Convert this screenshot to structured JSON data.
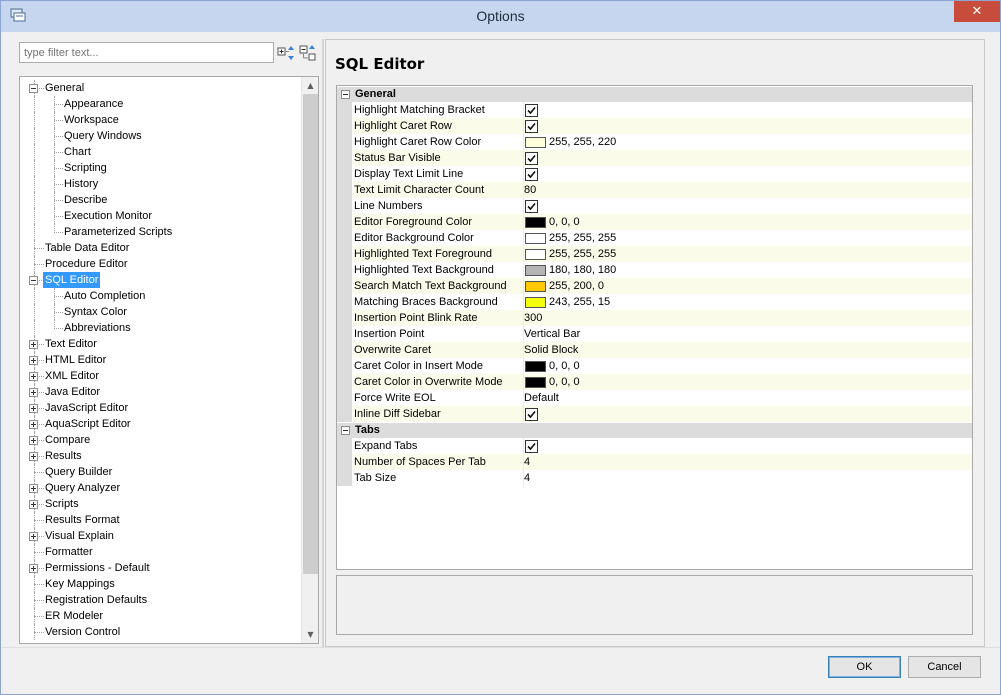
{
  "window": {
    "title": "Options",
    "close_glyph": "✕",
    "close_icon": "close-icon",
    "app_icon": "app-icon"
  },
  "filter": {
    "placeholder": "type filter text...",
    "value": "",
    "expand_icon": "expand-all-icon",
    "collapse_icon": "collapse-all-icon"
  },
  "tree": {
    "selected": "SQL Editor",
    "items": [
      {
        "label": "General",
        "depth": 0,
        "expander": "minus"
      },
      {
        "label": "Appearance",
        "depth": 1
      },
      {
        "label": "Workspace",
        "depth": 1
      },
      {
        "label": "Query Windows",
        "depth": 1
      },
      {
        "label": "Chart",
        "depth": 1
      },
      {
        "label": "Scripting",
        "depth": 1
      },
      {
        "label": "History",
        "depth": 1
      },
      {
        "label": "Describe",
        "depth": 1
      },
      {
        "label": "Execution Monitor",
        "depth": 1
      },
      {
        "label": "Parameterized Scripts",
        "depth": 1
      },
      {
        "label": "Table Data Editor",
        "depth": 0
      },
      {
        "label": "Procedure Editor",
        "depth": 0
      },
      {
        "label": "SQL Editor",
        "depth": 0,
        "expander": "minus"
      },
      {
        "label": "Auto Completion",
        "depth": 1
      },
      {
        "label": "Syntax Color",
        "depth": 1
      },
      {
        "label": "Abbreviations",
        "depth": 1
      },
      {
        "label": "Text Editor",
        "depth": 0,
        "expander": "plus"
      },
      {
        "label": "HTML Editor",
        "depth": 0,
        "expander": "plus"
      },
      {
        "label": "XML Editor",
        "depth": 0,
        "expander": "plus"
      },
      {
        "label": "Java Editor",
        "depth": 0,
        "expander": "plus"
      },
      {
        "label": "JavaScript Editor",
        "depth": 0,
        "expander": "plus"
      },
      {
        "label": "AquaScript Editor",
        "depth": 0,
        "expander": "plus"
      },
      {
        "label": "Compare",
        "depth": 0,
        "expander": "plus"
      },
      {
        "label": "Results",
        "depth": 0,
        "expander": "plus"
      },
      {
        "label": "Query Builder",
        "depth": 0
      },
      {
        "label": "Query Analyzer",
        "depth": 0,
        "expander": "plus"
      },
      {
        "label": "Scripts",
        "depth": 0,
        "expander": "plus"
      },
      {
        "label": "Results Format",
        "depth": 0
      },
      {
        "label": "Visual Explain",
        "depth": 0,
        "expander": "plus"
      },
      {
        "label": "Formatter",
        "depth": 0
      },
      {
        "label": "Permissions - Default",
        "depth": 0,
        "expander": "plus"
      },
      {
        "label": "Key Mappings",
        "depth": 0
      },
      {
        "label": "Registration Defaults",
        "depth": 0
      },
      {
        "label": "ER Modeler",
        "depth": 0
      },
      {
        "label": "Version Control",
        "depth": 0
      }
    ]
  },
  "page": {
    "title": "SQL Editor",
    "categories": [
      {
        "name": "General",
        "props": [
          {
            "name": "Highlight Matching Bracket",
            "type": "check",
            "checked": true
          },
          {
            "name": "Highlight Caret Row",
            "type": "check",
            "checked": true
          },
          {
            "name": "Highlight Caret Row Color",
            "type": "color",
            "color": "#ffffdc",
            "text": "255, 255, 220"
          },
          {
            "name": "Status Bar Visible",
            "type": "check",
            "checked": true
          },
          {
            "name": "Display Text Limit Line",
            "type": "check",
            "checked": true
          },
          {
            "name": "Text Limit Character Count",
            "type": "text",
            "text": "80"
          },
          {
            "name": "Line Numbers",
            "type": "check",
            "checked": true
          },
          {
            "name": "Editor Foreground Color",
            "type": "color",
            "color": "#000000",
            "text": "0, 0, 0"
          },
          {
            "name": "Editor Background Color",
            "type": "color",
            "color": "#ffffff",
            "text": "255, 255, 255"
          },
          {
            "name": "Highlighted Text Foreground",
            "type": "color",
            "color": "#ffffff",
            "text": "255, 255, 255"
          },
          {
            "name": "Highlighted Text Background",
            "type": "color",
            "color": "#b4b4b4",
            "text": "180, 180, 180"
          },
          {
            "name": "Search Match Text Background",
            "type": "color",
            "color": "#ffc800",
            "text": "255, 200, 0"
          },
          {
            "name": "Matching Braces Background",
            "type": "color",
            "color": "#f3ff0f",
            "text": "243, 255, 15"
          },
          {
            "name": "Insertion Point Blink Rate",
            "type": "text",
            "text": "300"
          },
          {
            "name": "Insertion Point",
            "type": "text",
            "text": "Vertical Bar"
          },
          {
            "name": "Overwrite Caret",
            "type": "text",
            "text": "Solid Block"
          },
          {
            "name": "Caret Color in Insert Mode",
            "type": "color",
            "color": "#000000",
            "text": "0, 0, 0"
          },
          {
            "name": "Caret Color in Overwrite Mode",
            "type": "color",
            "color": "#000000",
            "text": "0, 0, 0"
          },
          {
            "name": "Force Write EOL",
            "type": "text",
            "text": "Default"
          },
          {
            "name": "Inline Diff Sidebar",
            "type": "check",
            "checked": true
          }
        ]
      },
      {
        "name": "Tabs",
        "props": [
          {
            "name": "Expand Tabs",
            "type": "check",
            "checked": true
          },
          {
            "name": "Number of Spaces Per Tab",
            "type": "text",
            "text": "4"
          },
          {
            "name": "Tab Size",
            "type": "text",
            "text": "4"
          }
        ]
      }
    ]
  },
  "buttons": {
    "ok": "OK",
    "cancel": "Cancel"
  }
}
